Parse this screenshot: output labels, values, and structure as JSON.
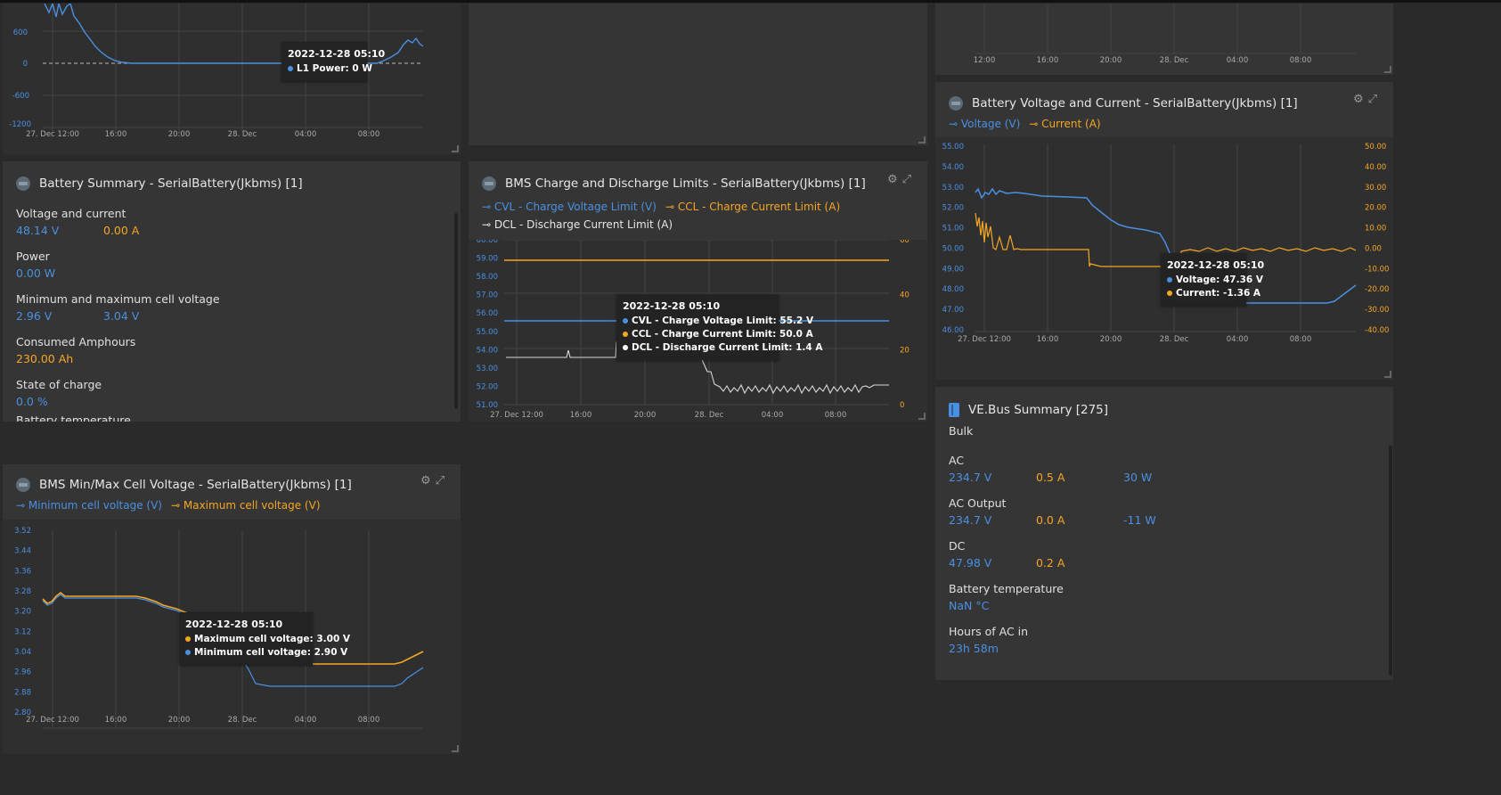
{
  "power_chart": {
    "y_ticks": [
      "600",
      "0",
      "-600",
      "-1200"
    ],
    "x_ticks": [
      "27. Dec 12:00",
      "16:00",
      "20:00",
      "28. Dec",
      "04:00",
      "08:00"
    ],
    "tooltip": {
      "time": "2022-12-28 05:10",
      "line1": "L1 Power: 0 W"
    }
  },
  "top_right_chart": {
    "x_ticks": [
      "12:00",
      "16:00",
      "20:00",
      "28. Dec",
      "04:00",
      "08:00"
    ]
  },
  "battery_summary": {
    "title": "Battery Summary - SerialBattery(Jkbms) [1]",
    "rows": [
      {
        "label": "Voltage and current",
        "v1": "48.14 V",
        "v2": "0.00 A"
      },
      {
        "label": "Power",
        "v1": "0.00 W"
      },
      {
        "label": "Minimum and maximum cell voltage",
        "v1": "2.96 V",
        "v2": "3.04 V"
      },
      {
        "label": "Consumed Amphours",
        "v1": "230.00 Ah"
      },
      {
        "label": "State of charge",
        "v1": "0.0 %"
      },
      {
        "label": "Battery temperature"
      }
    ]
  },
  "bms_limits": {
    "title": "BMS Charge and Discharge Limits - SerialBattery(Jkbms) [1]",
    "legend": [
      "CVL - Charge Voltage Limit (V)",
      "CCL - Charge Current Limit (A)",
      "DCL - Discharge Current Limit (A)"
    ],
    "tooltip": {
      "time": "2022-12-28 05:10",
      "l1": "CVL - Charge Voltage Limit: ",
      "v1": "55.2 V",
      "l2": "CCL - Charge Current Limit: ",
      "v2": "50.0 A",
      "l3": "DCL - Discharge Current Limit: ",
      "v3": "1.4 A"
    }
  },
  "batt_vc": {
    "title": "Battery Voltage and Current - SerialBattery(Jkbms) [1]",
    "legend": [
      "Voltage (V)",
      "Current (A)"
    ],
    "tooltip": {
      "time": "2022-12-28 05:10",
      "l1": "Voltage: ",
      "v1": "47.36 V",
      "l2": "Current: ",
      "v2": "-1.36 A"
    }
  },
  "cell_voltage": {
    "title": "BMS Min/Max Cell Voltage - SerialBattery(Jkbms) [1]",
    "legend": [
      "Minimum cell voltage (V)",
      "Maximum cell voltage (V)"
    ],
    "tooltip": {
      "time": "2022-12-28 05:10",
      "l1": "Maximum cell voltage: ",
      "v1": "3.00 V",
      "l2": "Minimum cell voltage: ",
      "v2": "2.90 V"
    }
  },
  "vebus": {
    "title": "VE.Bus Summary [275]",
    "state": "Bulk",
    "rows": [
      {
        "label": "AC",
        "v1": "234.7 V",
        "v2": "0.5 A",
        "v3": "30 W"
      },
      {
        "label": "AC Output",
        "v1": "234.7 V",
        "v2": "0.0 A",
        "v3": "-11 W"
      },
      {
        "label": "DC",
        "v1": "47.98 V",
        "v2": "0.2 A"
      },
      {
        "label": "Battery temperature",
        "v1": "NaN °C"
      },
      {
        "label": "Hours of AC in",
        "v1": "23h 58m"
      }
    ]
  },
  "chart_data": [
    {
      "type": "line",
      "title": "",
      "x_ticks": [
        "27. Dec 12:00",
        "16:00",
        "20:00",
        "28. Dec",
        "04:00",
        "08:00"
      ],
      "ylim": [
        -1200,
        1000
      ],
      "y_ticks": [
        600,
        0,
        -600,
        -1200
      ],
      "series": [
        {
          "name": "L1 Power",
          "color": "#4a90e2",
          "values": [
            1000,
            980,
            900,
            700,
            400,
            150,
            30,
            -10,
            0,
            0,
            0,
            0,
            0,
            0,
            0,
            0,
            0,
            0,
            0,
            0,
            0,
            0,
            40,
            120,
            200,
            280,
            230
          ]
        }
      ]
    },
    {
      "type": "line",
      "title": "BMS Charge and Discharge Limits - SerialBattery(Jkbms) [1]",
      "x_ticks": [
        "27. Dec 12:00",
        "16:00",
        "20:00",
        "28. Dec",
        "04:00",
        "08:00"
      ],
      "y_ticks_left": [
        51,
        52,
        53,
        54,
        55,
        56,
        57,
        58,
        59,
        60
      ],
      "y_ticks_right": [
        0,
        20,
        40,
        60
      ],
      "series": [
        {
          "name": "CVL - Charge Voltage Limit (V)",
          "values": [
            55.2,
            55.2,
            55.2,
            55.2,
            55.2,
            55.2,
            55.2,
            55.2
          ]
        },
        {
          "name": "CCL - Charge Current Limit (A)",
          "values": [
            50,
            50,
            50,
            50,
            50,
            50,
            50,
            50
          ]
        },
        {
          "name": "DCL - Discharge Current Limit (A)",
          "values": [
            15,
            15,
            15,
            16,
            16,
            5,
            4,
            4
          ]
        }
      ]
    },
    {
      "type": "line",
      "title": "Battery Voltage and Current - SerialBattery(Jkbms) [1]",
      "x_ticks": [
        "27. Dec 12:00",
        "16:00",
        "20:00",
        "28. Dec",
        "04:00",
        "08:00"
      ],
      "y_ticks_left": [
        46,
        47,
        48,
        49,
        50,
        51,
        52,
        53,
        54,
        55
      ],
      "y_ticks_right": [
        -40,
        -30,
        -20,
        -10,
        0,
        10,
        20,
        30,
        40,
        50
      ],
      "series": [
        {
          "name": "Voltage (V)",
          "values": [
            52.5,
            52.6,
            52.5,
            52.4,
            52.4,
            51.8,
            51.0,
            50.8,
            47.4,
            47.36,
            47.36,
            47.36,
            47.4,
            48.2
          ]
        },
        {
          "name": "Current (A)",
          "values": [
            15,
            10,
            2,
            0,
            0,
            0,
            0,
            -6,
            -6,
            -6,
            0,
            0,
            0,
            0
          ]
        }
      ]
    },
    {
      "type": "line",
      "title": "BMS Min/Max Cell Voltage - SerialBattery(Jkbms) [1]",
      "x_ticks": [
        "27. Dec 12:00",
        "16:00",
        "20:00",
        "28. Dec",
        "04:00",
        "08:00"
      ],
      "y_ticks": [
        2.8,
        2.88,
        2.96,
        3.04,
        3.12,
        3.2,
        3.28,
        3.36,
        3.44,
        3.52
      ],
      "series": [
        {
          "name": "Minimum cell voltage (V)",
          "values": [
            3.26,
            3.28,
            3.28,
            3.28,
            3.24,
            3.2,
            3.19,
            2.98,
            2.9,
            2.9,
            2.9,
            2.9,
            2.96
          ]
        },
        {
          "name": "Maximum cell voltage (V)",
          "values": [
            3.26,
            3.29,
            3.28,
            3.28,
            3.25,
            3.21,
            3.2,
            3.0,
            3.0,
            3.0,
            3.0,
            3.0,
            3.04
          ]
        }
      ]
    }
  ]
}
